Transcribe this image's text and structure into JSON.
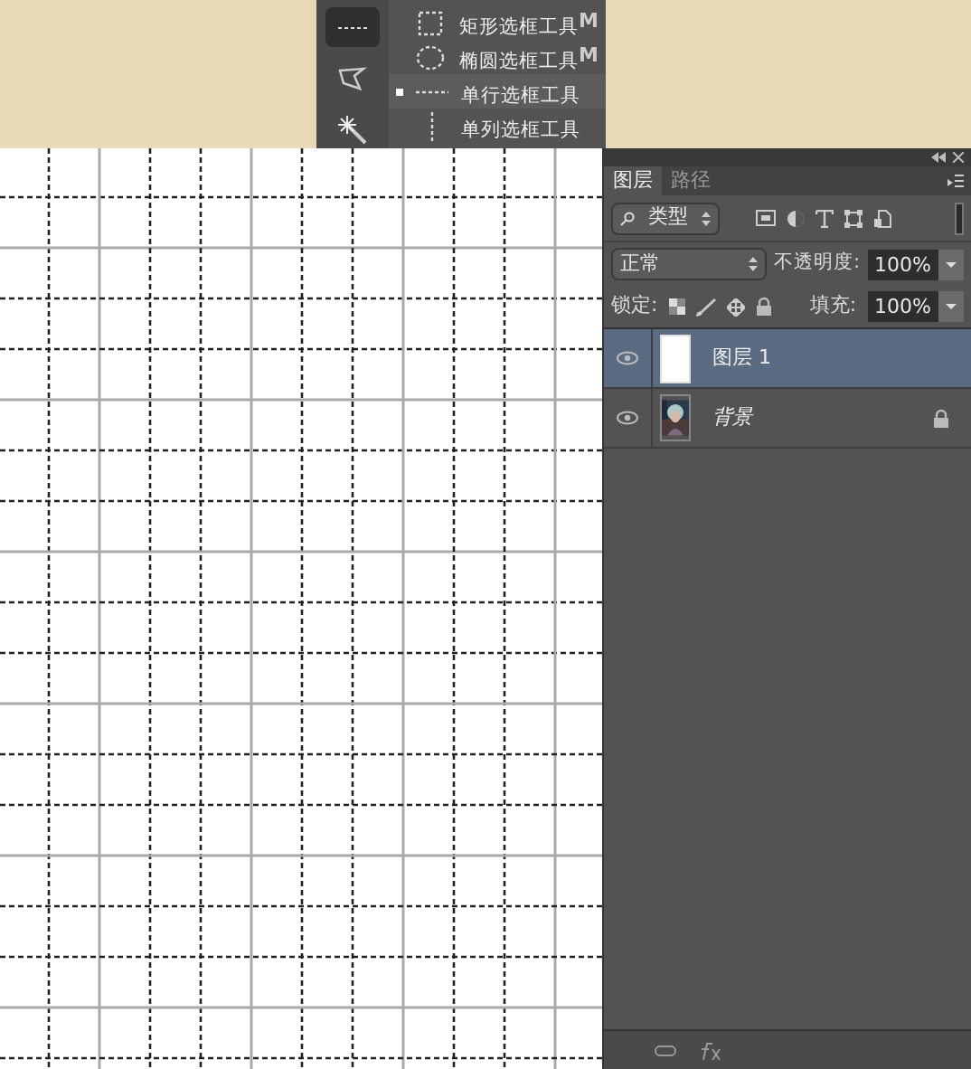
{
  "tool_menu": {
    "items": [
      {
        "label": "矩形选框工具",
        "shortcut": "M",
        "selected": false,
        "kind": "rect"
      },
      {
        "label": "椭圆选框工具",
        "shortcut": "M",
        "selected": false,
        "kind": "ellipse"
      },
      {
        "label": "单行选框工具",
        "selected": true,
        "kind": "row"
      },
      {
        "label": "单列选框工具",
        "selected": false,
        "kind": "column"
      }
    ]
  },
  "layers_panel": {
    "tabs": [
      {
        "label": "图层",
        "selected": true
      },
      {
        "label": "路径",
        "selected": false
      }
    ],
    "filter": {
      "value": "类型"
    },
    "blend_mode": {
      "value": "正常"
    },
    "opacity": {
      "label": "不透明度:",
      "value": "100%"
    },
    "lock": {
      "label": "锁定:"
    },
    "fill": {
      "label": "填充:",
      "value": "100%"
    },
    "layers": [
      {
        "name": "图层 1",
        "selected": true,
        "visible": true,
        "locked": false,
        "italic": false,
        "kind": "blank"
      },
      {
        "name": "背景",
        "selected": false,
        "visible": true,
        "locked": true,
        "italic": true
      }
    ]
  }
}
